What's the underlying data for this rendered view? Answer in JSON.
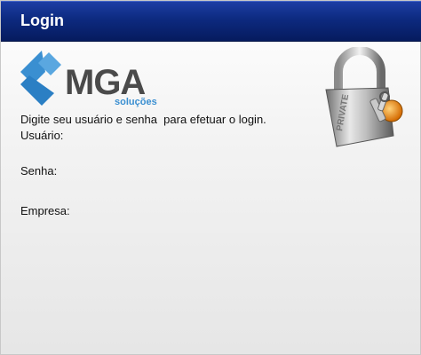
{
  "window": {
    "title": "Login"
  },
  "logo": {
    "name": "MGA",
    "subtitle": "soluções",
    "icon": "mga-logo-mark"
  },
  "lock_image": {
    "icon": "padlock-with-keys",
    "engraving": "PRIVATE"
  },
  "form": {
    "instruction": "Digite seu usuário e senha  para efetuar o login.",
    "user_label": "Usuário:",
    "password_label": "Senha:",
    "company_label": "Empresa:"
  },
  "colors": {
    "titlebar": "#0d2a80",
    "logo_blue": "#3a8fd1",
    "logo_gray": "#4a4a4a"
  }
}
